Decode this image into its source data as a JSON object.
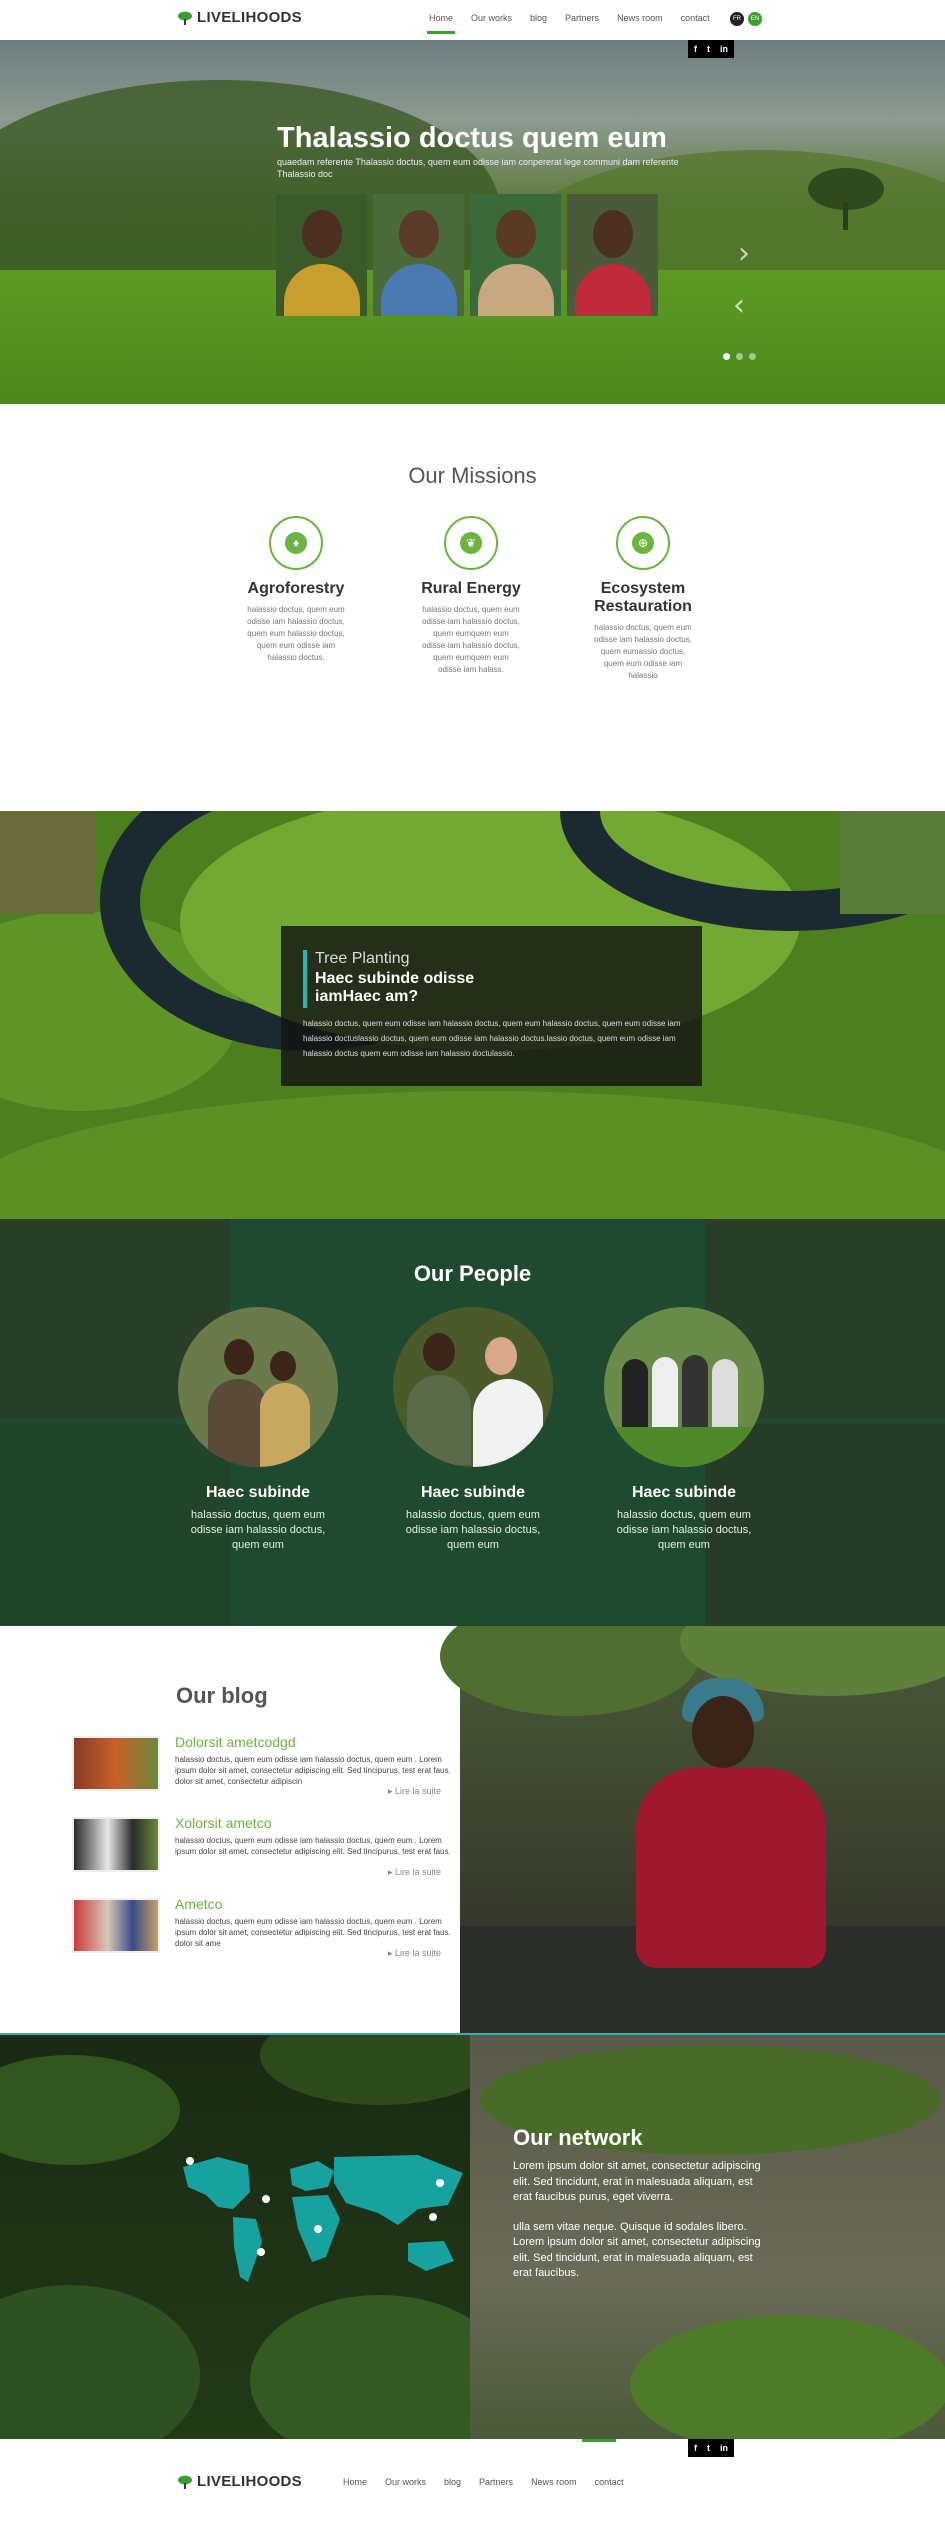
{
  "header": {
    "logo_text": "LIVELIHOODS",
    "nav": [
      "Home",
      "Our works",
      "blog",
      "Partners",
      "News room",
      "contact"
    ],
    "lang": [
      "FR",
      "EN"
    ],
    "social": [
      "f",
      "t",
      "in"
    ]
  },
  "hero": {
    "title": "Thalassio doctus quem eum",
    "subtitle": "quaedam referente Thalassio doctus, quem eum odisse iam conpererat lege communi dam referente Thalassio doc",
    "prev_arrow": "‹",
    "next_arrow": "›"
  },
  "missions": {
    "title": "Our Missions",
    "items": [
      {
        "title": "Agroforestry",
        "text": "halassio doctus, quem eum odisse iam halassio doctus, quem eum halassio doctus, quem eum odisse iam halassio doctus.",
        "icon": "bulb-icon",
        "glyph": "♦"
      },
      {
        "title": "Rural Energy",
        "text": "halassio doctus, quem eum odisse iam halassio doctus, quem eumquem eum odisse iam halassio doctus, quem eumquem eum odisse iam halass.",
        "icon": "leaf-icon",
        "glyph": "❦"
      },
      {
        "title": "Ecosystem Restauration",
        "text": "halassio doctus, quem eum odisse iam halassio doctus, quem eumassio doctus, quem eum odisse iam halassio",
        "icon": "globe-icon",
        "glyph": "⊕"
      }
    ]
  },
  "tree_planting": {
    "kicker": "Tree Planting",
    "heading": "Haec subinde odisse iamHaec am?",
    "body": "halassio doctus, quem eum odisse iam halassio doctus, quem eum halassio doctus, quem eum odisse iam halassio doctuslassio doctus, quem eum odisse iam halassio doctus.lassio doctus, quem eum odisse iam halassio doctus quem eum odisse iam halassio doctulassio."
  },
  "people": {
    "title": "Our People",
    "items": [
      {
        "title": "Haec subinde",
        "text": "halassio doctus, quem eum odisse iam halassio doctus, quem eum"
      },
      {
        "title": "Haec subinde",
        "text": "halassio doctus, quem eum odisse iam halassio doctus, quem eum"
      },
      {
        "title": "Haec subinde",
        "text": "halassio doctus, quem eum odisse iam halassio doctus, quem eum"
      }
    ]
  },
  "blog": {
    "title": "Our blog",
    "posts": [
      {
        "title": "Dolorsit ametcodgd",
        "text": "halassio doctus, quem eum odisse iam halassio doctus, quem eum . Lorem ipsum dolor sit amet, consectetur adipiscing elit. Sed tincipurus, test erat faus. dolor sit amet, consectetur adipiscin",
        "more": "Lire la suite"
      },
      {
        "title": "Xolorsit ametco",
        "text": "halassio doctus, quem eum odisse iam halassio doctus, quem eum . Lorem ipsum dolor sit amet, consectetur adipiscing elit. Sed tincipurus, test erat faus.",
        "more": "Lire la suite"
      },
      {
        "title": "Ametco",
        "text": "halassio doctus, quem eum odisse iam halassio doctus, quem eum . Lorem ipsum dolor sit amet, consectetur adipiscing elit. Sed tincipurus, test erat faus. dolor sit ame",
        "more": "Lire la suite"
      }
    ]
  },
  "network": {
    "title": "Our network",
    "p1": "Lorem ipsum dolor sit amet, consectetur adipiscing elit. Sed tincidunt, erat in malesuada aliquam, est erat faucibus purus, eget viverra.",
    "p2": "ulla sem vitae neque. Quisque id sodales libero. Lorem ipsum dolor sit amet, consectetur adipiscing elit. Sed tincidunt, erat in malesuada aliquam, est erat faucibus."
  },
  "footer": {
    "logo_text": "LIVELIHOODS",
    "nav": [
      "Home",
      "Our works",
      "blog",
      "Partners",
      "News room",
      "contact"
    ],
    "social": [
      "f",
      "t",
      "in"
    ]
  },
  "colors": {
    "accent": "#3aa02f",
    "mission_green": "#6cb33f",
    "teal": "#2ab5b5"
  }
}
